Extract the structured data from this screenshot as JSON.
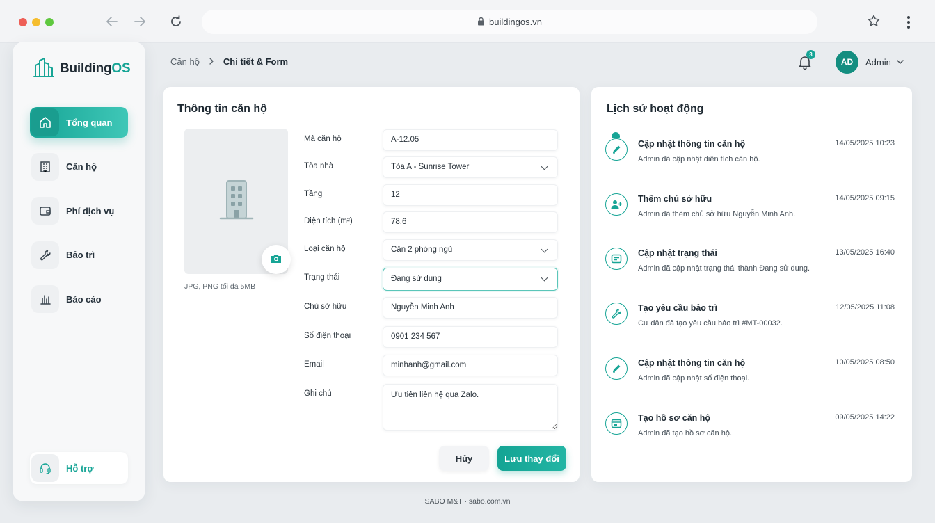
{
  "browser": {
    "url": "buildingos.vn"
  },
  "brand": {
    "name_main": "Building",
    "name_accent": "OS"
  },
  "sidebar": {
    "items": [
      {
        "label": "Tổng quan",
        "icon": "home-icon",
        "active": true
      },
      {
        "label": "Căn hộ",
        "icon": "building-icon",
        "active": false
      },
      {
        "label": "Phí dịch vụ",
        "icon": "wallet-icon",
        "active": false
      },
      {
        "label": "Bảo trì",
        "icon": "wrench-icon",
        "active": false
      },
      {
        "label": "Báo cáo",
        "icon": "bar-chart-icon",
        "active": false
      }
    ],
    "support_label": "Hỗ trợ"
  },
  "header": {
    "breadcrumb_parent": "Căn hộ",
    "breadcrumb_current": "Chi tiết & Form",
    "notification_count": "3",
    "avatar_initials": "AD",
    "user_name": "Admin"
  },
  "form": {
    "title": "Thông tin căn hộ",
    "photo_hint": "JPG, PNG tối đa 5MB",
    "fields": [
      {
        "label": "Mã căn hộ",
        "value": "A-12.05"
      },
      {
        "label": "Tòa nhà",
        "value": "Tòa A - Sunrise Tower"
      },
      {
        "label": "Tầng",
        "value": "12"
      },
      {
        "label": "Diện tích (m²)",
        "value": "78.6"
      },
      {
        "label": "Loại căn hộ",
        "value": "Căn 2 phòng ngủ"
      },
      {
        "label": "Trạng thái",
        "value": "Đang sử dụng"
      },
      {
        "label": "Chủ sở hữu",
        "value": "Nguyễn Minh Anh"
      },
      {
        "label": "Số điện thoại",
        "value": "0901 234 567"
      },
      {
        "label": "Email",
        "value": "minhanh@gmail.com"
      },
      {
        "label": "Ghi chú",
        "value": "Ưu tiên liên hệ qua Zalo."
      }
    ],
    "cancel_label": "Hủy",
    "save_label": "Lưu thay đổi"
  },
  "history": {
    "title": "Lịch sử hoạt động",
    "items": [
      {
        "title": "Cập nhật thông tin căn hộ",
        "desc": "Admin đã cập nhật diện tích căn hộ.",
        "time": "14/05/2025 10:23",
        "icon": "pencil-icon"
      },
      {
        "title": "Thêm chủ sở hữu",
        "desc": "Admin đã thêm chủ sở hữu Nguyễn Minh Anh.",
        "time": "14/05/2025 09:15",
        "icon": "user-plus-icon"
      },
      {
        "title": "Cập nhật trạng thái",
        "desc": "Admin đã cập nhật trạng thái thành Đang sử dụng.",
        "time": "13/05/2025 16:40",
        "icon": "status-card-icon"
      },
      {
        "title": "Tạo yêu cầu bảo trì",
        "desc": "Cư dân đã tạo yêu cầu bảo trì #MT-00032.",
        "time": "12/05/2025 11:08",
        "icon": "wrench-icon"
      },
      {
        "title": "Cập nhật thông tin căn hộ",
        "desc": "Admin đã cập nhật số điện thoại.",
        "time": "10/05/2025 08:50",
        "icon": "pencil-icon"
      },
      {
        "title": "Tạo hồ sơ căn hộ",
        "desc": "Admin đã tạo hồ sơ căn hộ.",
        "time": "09/05/2025 14:22",
        "icon": "id-card-icon"
      }
    ]
  },
  "footer": {
    "text": "SABO M&T · sabo.com.vn"
  },
  "colors": {
    "accent": "#17a596",
    "background": "#e9ecef"
  }
}
